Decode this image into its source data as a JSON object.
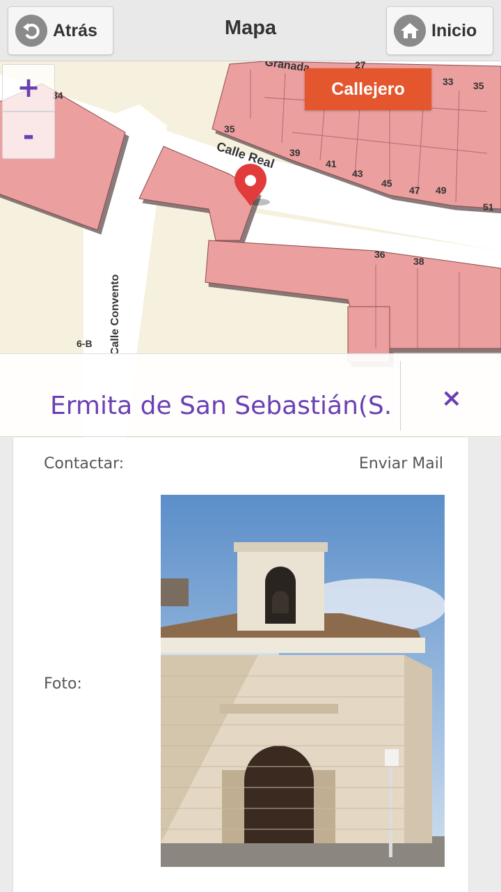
{
  "header": {
    "back_label": "Atrás",
    "back_icon": "undo-arrow-icon",
    "title": "Mapa",
    "home_label": "Inicio",
    "home_icon": "house-icon"
  },
  "map": {
    "zoom_in": "+",
    "zoom_out": "-",
    "callejero_label": "Callejero",
    "streets": [
      "Granada",
      "Calle Real",
      "Calle Convento"
    ],
    "house_numbers": [
      "34",
      "27",
      "33",
      "35",
      "35",
      "39",
      "41",
      "43",
      "45",
      "47",
      "49",
      "51",
      "36",
      "38",
      "6-B"
    ],
    "marker_icon": "map-pin-icon",
    "colors": {
      "building": "#ec9f9f",
      "road": "#ffffff",
      "land": "#f6f1de",
      "accent": "#e4572e"
    }
  },
  "info": {
    "title": "Ermita de San Sebastián(S.",
    "close": "×",
    "contact_label": "Contactar:",
    "contact_value": "Enviar Mail",
    "photo_label": "Foto:"
  },
  "theme": {
    "purple": "#6a3fb3"
  }
}
